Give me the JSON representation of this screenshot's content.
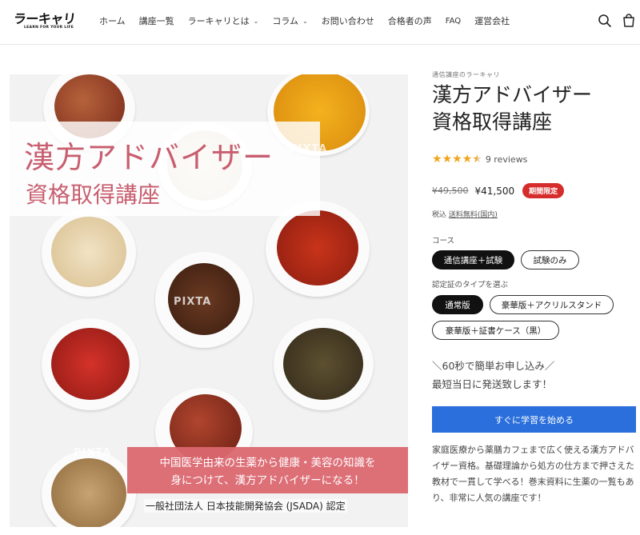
{
  "header": {
    "logo_text": "ラーキャリ",
    "logo_tagline": "LEARN FOR YOUR LIFE",
    "nav": [
      {
        "label": "ホーム",
        "dropdown": false
      },
      {
        "label": "講座一覧",
        "dropdown": false
      },
      {
        "label": "ラーキャリとは",
        "dropdown": true
      },
      {
        "label": "コラム",
        "dropdown": true
      },
      {
        "label": "お問い合わせ",
        "dropdown": false
      },
      {
        "label": "合格者の声",
        "dropdown": false
      },
      {
        "label": "FAQ",
        "dropdown": false
      },
      {
        "label": "運営会社",
        "dropdown": false
      }
    ],
    "icons": [
      "search-icon",
      "cart-icon"
    ]
  },
  "hero": {
    "title_line1": "漢方アドバイザー",
    "title_line2": "資格取得講座",
    "watermark": "PIXTA",
    "catch_line1": "中国医学由来の生薬から健康・美容の知識を",
    "catch_line2": "身につけて、漢方アドバイザーになる！",
    "credit": "一般社団法人 日本技能開発協会 (JSADA) 認定"
  },
  "product": {
    "vendor": "通信講座のラーキャリ",
    "title_line1": "漢方アドバイザー",
    "title_line2": "資格取得講座",
    "rating": 4.5,
    "reviews": "9 reviews",
    "price_old": "¥49,500",
    "price_new": "¥41,500",
    "badge": "期間限定",
    "tax_prefix": "税込",
    "tax_link": "送料無料(国内)",
    "course_label": "コース",
    "course_options": [
      {
        "label": "通信講座＋試験",
        "selected": true
      },
      {
        "label": "試験のみ",
        "selected": false
      }
    ],
    "cert_label": "認定証のタイプを選ぶ",
    "cert_options": [
      {
        "label": "通常版",
        "selected": true
      },
      {
        "label": "豪華版＋アクリルスタンド",
        "selected": false
      },
      {
        "label": "豪華版＋証書ケース（黒）",
        "selected": false
      }
    ],
    "promo_line1": "＼60秒で簡単お申し込み／",
    "promo_line2": "最短当日に発送致します！",
    "buy_button": "すぐに学習を始める",
    "description": "家庭医療から薬膳カフェまで広く使える漢方アドバイザー資格。基礎理論から処方の仕方まで押さえた教材で一貫して学べる！巻末資料に生薬の一覧もあり、非常に人気の講座です！"
  },
  "colors": {
    "accent_blue": "#2a6fdc",
    "badge_red": "#d62c2c",
    "star": "#f0a41c",
    "title_pink": "#c85e6f"
  }
}
